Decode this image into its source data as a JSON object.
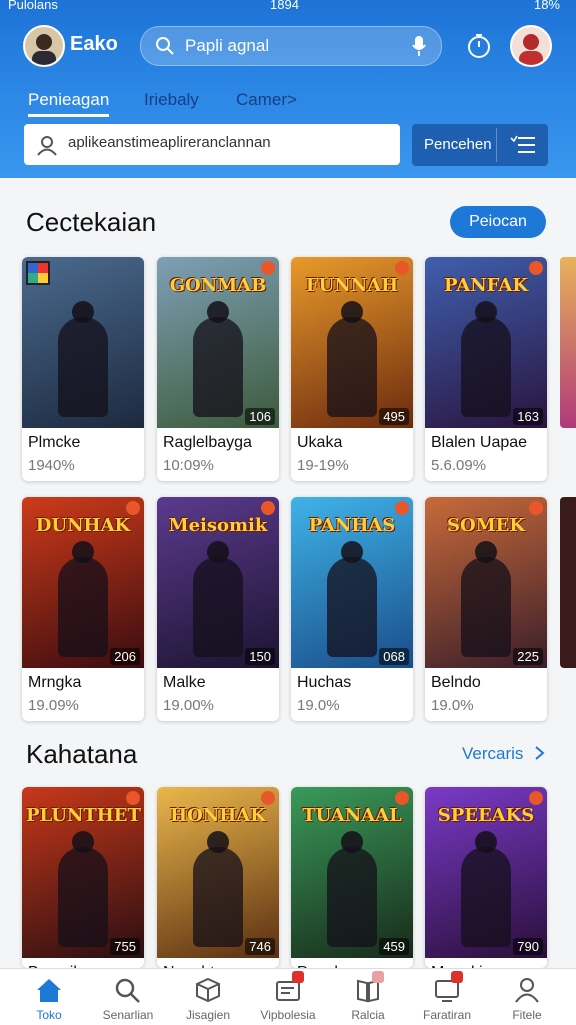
{
  "status": {
    "left": "Pulolans",
    "time": "1894",
    "battery": "18%"
  },
  "header": {
    "brand": "Eako",
    "search_placeholder": "Papli agnal",
    "tabs": [
      "Penieagan",
      "Iriebaly",
      "Camer>"
    ],
    "tab_colors": [
      "#ffffff",
      "#173e86",
      "#173e86"
    ]
  },
  "search": {
    "value": "aplikeanstimeaplireranclannan",
    "button_label": "Pencehen"
  },
  "sections": [
    {
      "title": "Cectekaian",
      "action": "Peiocan",
      "games": [
        {
          "title": "Plmcke",
          "stat": "1940%",
          "count": "",
          "cover_title": "",
          "c1": "#4b6a8f",
          "c2": "#1c2a3f"
        },
        {
          "title": "Raglelbayga",
          "stat": "10:09%",
          "count": "106",
          "cover_title": "GONMAB",
          "c1": "#7ea0b6",
          "c2": "#3c5a3a"
        },
        {
          "title": "Ukaka",
          "stat": "19-19%",
          "count": "495",
          "cover_title": "FUNNAH",
          "c1": "#e99a2a",
          "c2": "#6b2a0f"
        },
        {
          "title": "Blalen Uapae",
          "stat": "5.6.09%",
          "count": "163",
          "cover_title": "PANFAK",
          "c1": "#3f5fae",
          "c2": "#2a143f"
        },
        {
          "title": "Mrngka",
          "stat": "19.09%",
          "count": "206",
          "cover_title": "DUNHAK",
          "c1": "#ce3b1a",
          "c2": "#3a0c10"
        },
        {
          "title": "Malke",
          "stat": "19.00%",
          "count": "150",
          "cover_title": "Meisomik",
          "c1": "#5b3a8e",
          "c2": "#1c1430"
        },
        {
          "title": "Huchas",
          "stat": "19.0%",
          "count": "068",
          "cover_title": "PANHAS",
          "c1": "#3fb3e8",
          "c2": "#1a4d8a"
        },
        {
          "title": "Belndo",
          "stat": "19.0%",
          "count": "225",
          "cover_title": "SOMEK",
          "c1": "#c86a3a",
          "c2": "#3a1e2a"
        }
      ]
    },
    {
      "title": "Kahatana",
      "action": "Vercaris",
      "games": [
        {
          "title": "Bacraikn",
          "stat": "",
          "count": "755",
          "cover_title": "PLUNTHET",
          "c1": "#c8381a",
          "c2": "#2a0e12"
        },
        {
          "title": "Nenahtan",
          "stat": "",
          "count": "746",
          "cover_title": "HONHAK",
          "c1": "#eab74a",
          "c2": "#5a2e12"
        },
        {
          "title": "Panakan",
          "stat": "",
          "count": "459",
          "cover_title": "TUANAAL",
          "c1": "#3a9a5a",
          "c2": "#182a1a"
        },
        {
          "title": "Manakin",
          "stat": "",
          "count": "790",
          "cover_title": "SPEEAKS",
          "c1": "#7a3ac8",
          "c2": "#2a0f3a"
        }
      ]
    }
  ],
  "nav": [
    {
      "label": "Toko",
      "icon": "home-icon",
      "active": true
    },
    {
      "label": "Senarlian",
      "icon": "search-icon",
      "active": false
    },
    {
      "label": "Jisagien",
      "icon": "cube-icon",
      "active": false
    },
    {
      "label": "Vipbolesia",
      "icon": "card-icon",
      "active": false
    },
    {
      "label": "Ralcia",
      "icon": "book-icon",
      "active": false
    },
    {
      "label": "Faratiran",
      "icon": "screen-icon",
      "active": false
    },
    {
      "label": "Fitele",
      "icon": "user-icon",
      "active": false
    }
  ],
  "colors": {
    "accent": "#1e78d8",
    "header": "#2a80e0",
    "badge": "#e0302a"
  }
}
